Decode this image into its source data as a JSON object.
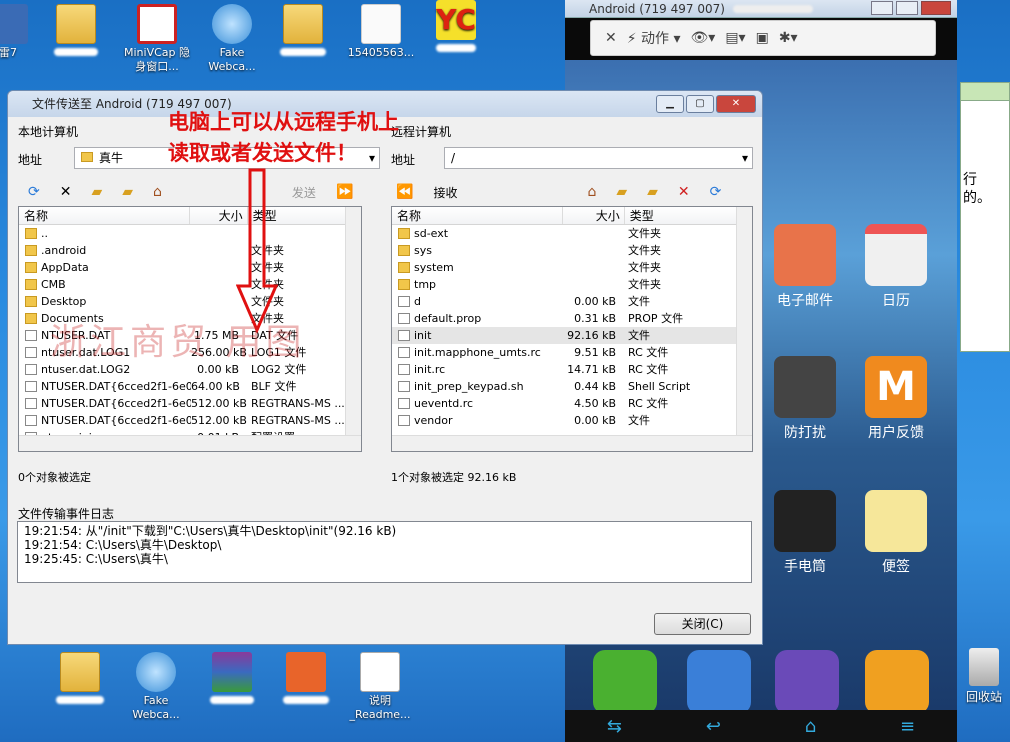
{
  "desktop": {
    "top_icons": [
      {
        "label": "雷7"
      },
      {
        "label": ""
      },
      {
        "label": "MiniVCap 隐身窗口..."
      },
      {
        "label": "Fake Webca..."
      },
      {
        "label": ""
      },
      {
        "label": "15405563..."
      },
      {
        "label": ""
      }
    ],
    "bottom_icons": [
      {
        "label": ""
      },
      {
        "label": "Fake Webca..."
      },
      {
        "label": ""
      },
      {
        "label": ""
      },
      {
        "label": "说明 _Readme..."
      }
    ],
    "recycle_bin": "回收站"
  },
  "android": {
    "title": "Android (719 497 007)",
    "toolbar": {
      "action_label": "动作"
    },
    "apps": [
      {
        "label": "电子邮件"
      },
      {
        "label": "日历"
      },
      {
        "label": "防打扰"
      },
      {
        "label": "用户反馈"
      },
      {
        "label": "手电筒"
      },
      {
        "label": "便签"
      }
    ],
    "colors": {
      "email": "#e8734a",
      "calendar": "#f0f0f0",
      "shield": "#444444",
      "feedback": "#f08a1e",
      "notes": "#f6e79a"
    }
  },
  "side_window": {
    "text_1": "行",
    "text_2": "的。"
  },
  "dialog": {
    "title": "文件传送至 Android (719 497 007)",
    "local_label": "本地计算机",
    "remote_label": "远程计算机",
    "address_label_local": "地址",
    "address_label_remote": "地址",
    "local_address": "真牛",
    "remote_address": "/",
    "send_label": "发送",
    "receive_label": "接收",
    "local_headers": {
      "name": "名称",
      "size": "大小",
      "type": "类型"
    },
    "remote_headers": {
      "name": "名称",
      "size": "大小",
      "type": "类型"
    },
    "local_files": [
      {
        "name": "..",
        "size": "",
        "type": ""
      },
      {
        "name": ".android",
        "size": "",
        "type": "文件夹"
      },
      {
        "name": "AppData",
        "size": "",
        "type": "文件夹"
      },
      {
        "name": "CMB",
        "size": "",
        "type": "文件夹"
      },
      {
        "name": "Desktop",
        "size": "",
        "type": "文件夹"
      },
      {
        "name": "Documents",
        "size": "",
        "type": "文件夹"
      },
      {
        "name": "NTUSER.DAT",
        "size": "1.75 MB",
        "type": "DAT 文件"
      },
      {
        "name": "ntuser.dat.LOG1",
        "size": "256.00 kB",
        "type": "LOG1 文件"
      },
      {
        "name": "ntuser.dat.LOG2",
        "size": "0.00 kB",
        "type": "LOG2 文件"
      },
      {
        "name": "NTUSER.DAT{6cced2f1-6e0...",
        "size": "64.00 kB",
        "type": "BLF 文件"
      },
      {
        "name": "NTUSER.DAT{6cced2f1-6e0...",
        "size": "512.00 kB",
        "type": "REGTRANS-MS ..."
      },
      {
        "name": "NTUSER.DAT{6cced2f1-6e0...",
        "size": "512.00 kB",
        "type": "REGTRANS-MS ..."
      },
      {
        "name": "ntuser.ini",
        "size": "0.01 kB",
        "type": "配置设置"
      }
    ],
    "remote_files": [
      {
        "name": "sd-ext",
        "size": "",
        "type": "文件夹"
      },
      {
        "name": "sys",
        "size": "",
        "type": "文件夹"
      },
      {
        "name": "system",
        "size": "",
        "type": "文件夹"
      },
      {
        "name": "tmp",
        "size": "",
        "type": "文件夹"
      },
      {
        "name": "d",
        "size": "0.00 kB",
        "type": "文件"
      },
      {
        "name": "default.prop",
        "size": "0.31 kB",
        "type": "PROP 文件"
      },
      {
        "name": "init",
        "size": "92.16 kB",
        "type": "文件"
      },
      {
        "name": "init.mapphone_umts.rc",
        "size": "9.51 kB",
        "type": "RC 文件"
      },
      {
        "name": "init.rc",
        "size": "14.71 kB",
        "type": "RC 文件"
      },
      {
        "name": "init_prep_keypad.sh",
        "size": "0.44 kB",
        "type": "Shell Script"
      },
      {
        "name": "ueventd.rc",
        "size": "4.50 kB",
        "type": "RC 文件"
      },
      {
        "name": "vendor",
        "size": "0.00 kB",
        "type": "文件"
      }
    ],
    "local_status": "0个对象被选定",
    "remote_status": "1个对象被选定  92.16 kB",
    "log_title": "文件传输事件日志",
    "log_lines": [
      "19:21:54: 从\"/init\"下载到\"C:\\Users\\真牛\\Desktop\\init\"(92.16 kB)",
      "19:21:54: C:\\Users\\真牛\\Desktop\\",
      "19:25:45: C:\\Users\\真牛\\"
    ],
    "close_label": "关闭(C)"
  },
  "annotation": {
    "line1": "电脑上可以从远程手机上",
    "line2": "读取或者发送文件！",
    "watermark": "浙江商贸  用图"
  }
}
